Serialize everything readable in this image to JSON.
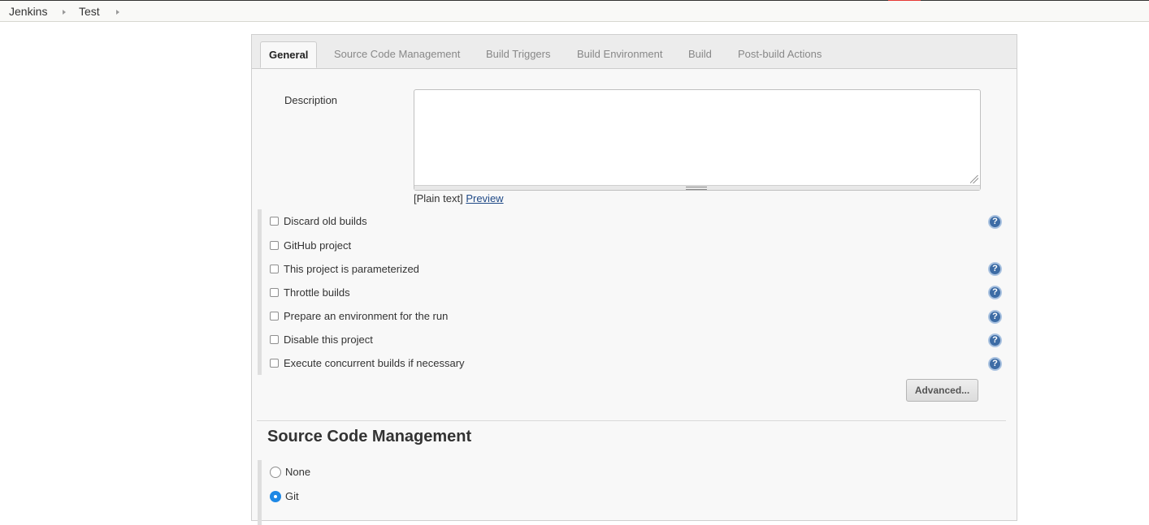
{
  "breadcrumb": [
    "Jenkins",
    "Test"
  ],
  "tabs": [
    "General",
    "Source Code Management",
    "Build Triggers",
    "Build Environment",
    "Build",
    "Post-build Actions"
  ],
  "active_tab": "General",
  "description": {
    "label": "Description",
    "value": "",
    "format_text": "[Plain text]",
    "preview_link": "Preview"
  },
  "options": [
    {
      "label": "Discard old builds",
      "checked": false,
      "help": true
    },
    {
      "label": "GitHub project",
      "checked": false,
      "help": false
    },
    {
      "label": "This project is parameterized",
      "checked": false,
      "help": true
    },
    {
      "label": "Throttle builds",
      "checked": false,
      "help": true
    },
    {
      "label": "Prepare an environment for the run",
      "checked": false,
      "help": true
    },
    {
      "label": "Disable this project",
      "checked": false,
      "help": true
    },
    {
      "label": "Execute concurrent builds if necessary",
      "checked": false,
      "help": true
    }
  ],
  "advanced_button": "Advanced...",
  "help_glyph": "?",
  "scm": {
    "title": "Source Code Management",
    "choices": [
      {
        "label": "None",
        "selected": false
      },
      {
        "label": "Git",
        "selected": true
      }
    ]
  },
  "colors": {
    "accent": "#1e88e5",
    "help_icon": "#3d6ca5",
    "link": "#204a87"
  }
}
